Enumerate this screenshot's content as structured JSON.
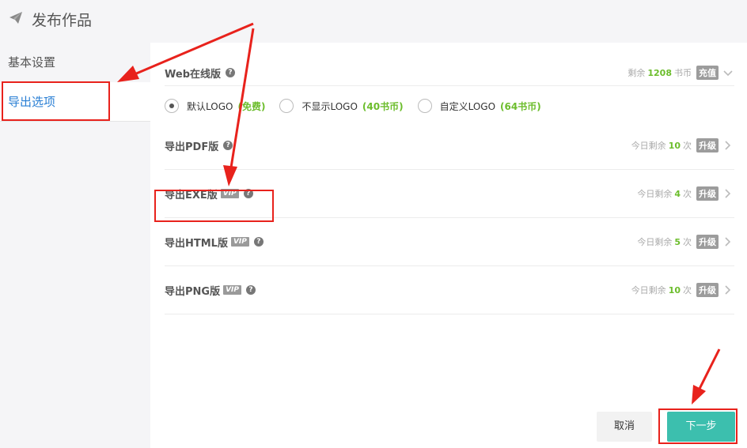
{
  "header": {
    "title": "发布作品",
    "icon": "paper-plane-icon"
  },
  "sidebar": {
    "items": [
      {
        "label": "基本设置"
      },
      {
        "label": "导出选项"
      }
    ]
  },
  "web": {
    "title": "Web在线版",
    "remaining_prefix": "剩余",
    "remaining_value": "1208",
    "remaining_unit": "书币",
    "recharge_label": "充值",
    "options": [
      {
        "label": "默认LOGO",
        "price": "(免费)",
        "checked": true
      },
      {
        "label": "不显示LOGO",
        "price": "(40书币)",
        "checked": false
      },
      {
        "label": "自定义LOGO",
        "price": "(64书币)",
        "checked": false
      }
    ]
  },
  "exports": [
    {
      "title": "导出PDF版",
      "vip": "",
      "prefix": "今日剩余",
      "value": "10",
      "suffix": "次",
      "upgrade": "升级"
    },
    {
      "title": "导出EXE版",
      "vip": "VIP",
      "prefix": "今日剩余",
      "value": "4",
      "suffix": "次",
      "upgrade": "升级"
    },
    {
      "title": "导出HTML版",
      "vip": "VIP",
      "prefix": "今日剩余",
      "value": "5",
      "suffix": "次",
      "upgrade": "升级"
    },
    {
      "title": "导出PNG版",
      "vip": "VIP",
      "prefix": "今日剩余",
      "value": "10",
      "suffix": "次",
      "upgrade": "升级"
    }
  ],
  "footer": {
    "cancel_label": "取消",
    "next_label": "下一步"
  },
  "colors": {
    "accent": "#3cbfae",
    "link": "#2a7fd4",
    "number": "#6cbd2c",
    "annotation": "#e8221c"
  }
}
